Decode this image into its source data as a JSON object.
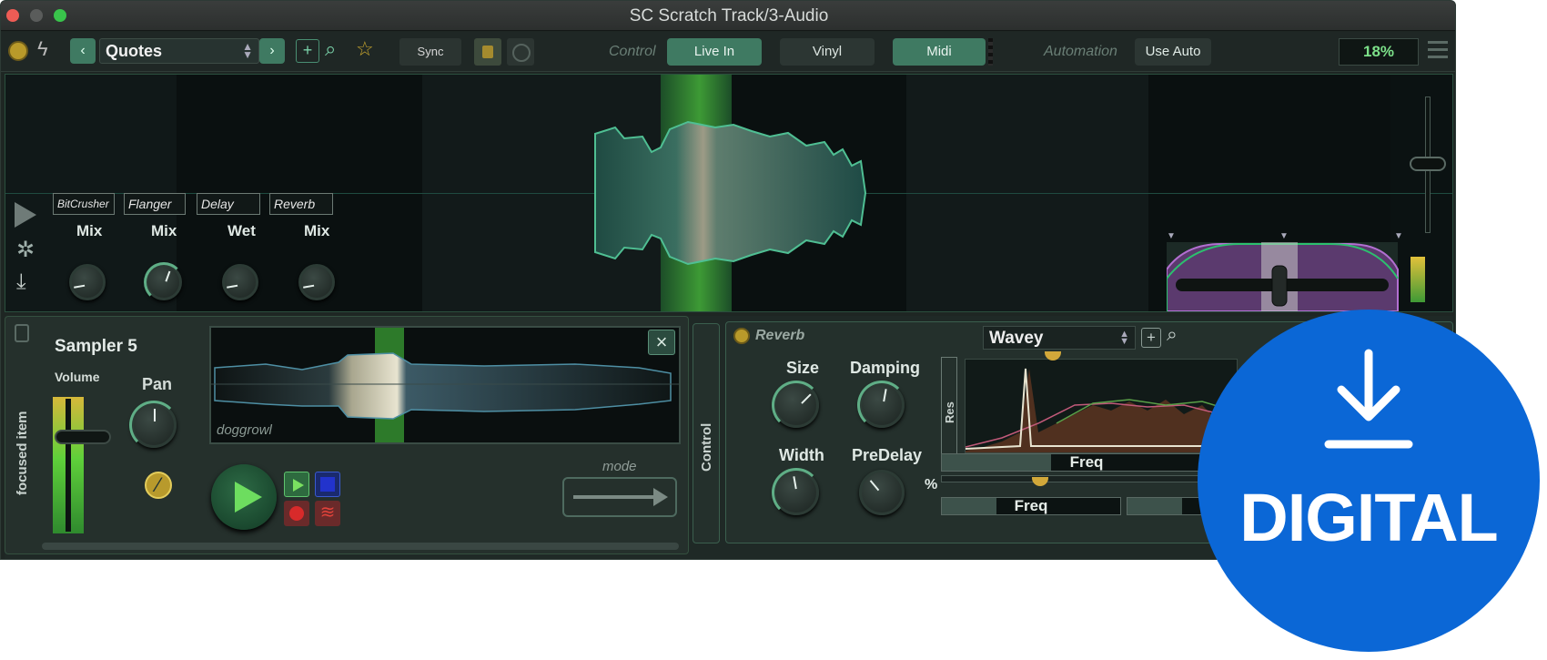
{
  "window": {
    "title": "SC Scratch Track/3-Audio"
  },
  "toolbar": {
    "preset": "Quotes",
    "sync": "Sync",
    "control_label": "Control",
    "modes": [
      "Live In",
      "Vinyl",
      "Midi"
    ],
    "automation_label": "Automation",
    "use_auto": "Use Auto",
    "cpu": "18%"
  },
  "effects": [
    {
      "name": "BitCrusher",
      "param": "Mix"
    },
    {
      "name": "Flanger",
      "param": "Mix"
    },
    {
      "name": "Delay",
      "param": "Wet"
    },
    {
      "name": "Reverb",
      "param": "Mix"
    }
  ],
  "sampler": {
    "focused_label": "focused item",
    "title": "Sampler 5",
    "volume_label": "Volume",
    "pan_label": "Pan",
    "sample_name": "doggrowl",
    "mode_label": "mode",
    "control_tab": "Control"
  },
  "reverb": {
    "title": "Reverb",
    "preset": "Wavey",
    "knobs": [
      "Size",
      "Damping",
      "Width",
      "PreDelay"
    ],
    "res_label": "Res",
    "freq_label": "Freq",
    "percent": "%"
  },
  "badge": {
    "text": "DIGITAL"
  },
  "colors": {
    "accent": "#3f7a62",
    "waveform": "#4fbf93",
    "badge": "#0b67d6"
  }
}
